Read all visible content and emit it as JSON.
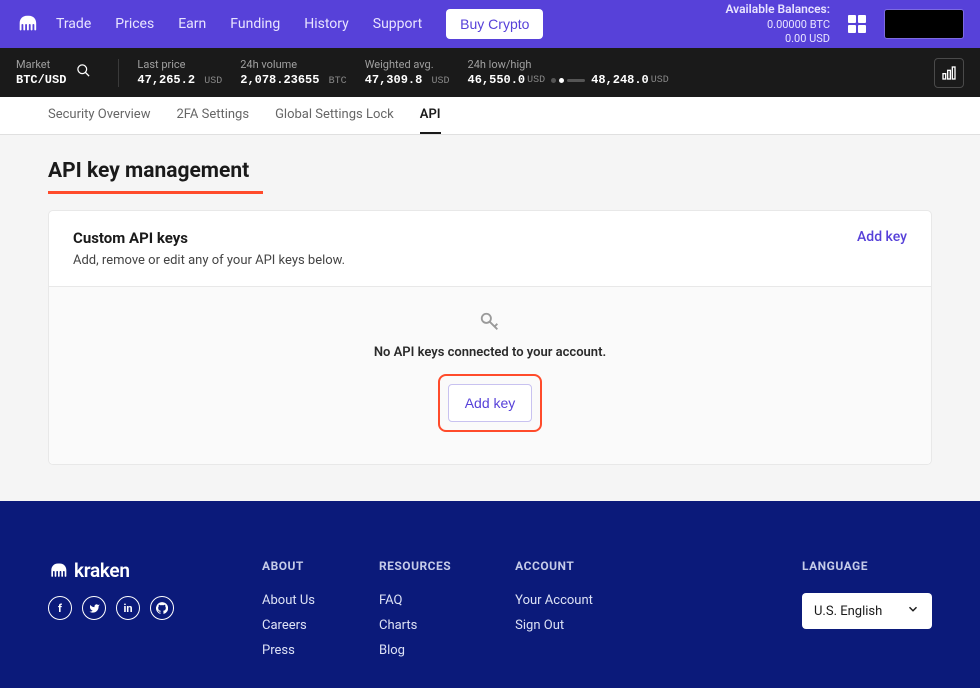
{
  "nav": {
    "links": [
      "Trade",
      "Prices",
      "Earn",
      "Funding",
      "History",
      "Support"
    ],
    "buy_label": "Buy Crypto"
  },
  "balances": {
    "label": "Available Balances:",
    "btc": "0.00000 BTC",
    "usd": "0.00 USD"
  },
  "market": {
    "pair_label": "Market",
    "pair": "BTC/USD",
    "last_label": "Last price",
    "last": "47,265.2",
    "last_unit": "USD",
    "vol_label": "24h volume",
    "vol": "2,078.23655",
    "vol_unit": "BTC",
    "wavg_label": "Weighted avg.",
    "wavg": "47,309.8",
    "wavg_unit": "USD",
    "range_label": "24h low/high",
    "low": "46,550.0",
    "low_unit": "USD",
    "high": "48,248.0",
    "high_unit": "USD"
  },
  "tabs": [
    "Security Overview",
    "2FA Settings",
    "Global Settings Lock",
    "API"
  ],
  "active_tab": "API",
  "page": {
    "title": "API key management",
    "card_title": "Custom API keys",
    "card_sub": "Add, remove or edit any of your API keys below.",
    "link_add": "Add key",
    "empty": "No API keys connected to your account.",
    "btn_add": "Add key"
  },
  "footer": {
    "brand": "kraken",
    "about": {
      "title": "ABOUT",
      "links": [
        "About Us",
        "Careers",
        "Press"
      ]
    },
    "resources": {
      "title": "RESOURCES",
      "links": [
        "FAQ",
        "Charts",
        "Blog"
      ]
    },
    "account": {
      "title": "ACCOUNT",
      "links": [
        "Your Account",
        "Sign Out"
      ]
    },
    "lang": {
      "title": "LANGUAGE",
      "value": "U.S. English"
    }
  }
}
